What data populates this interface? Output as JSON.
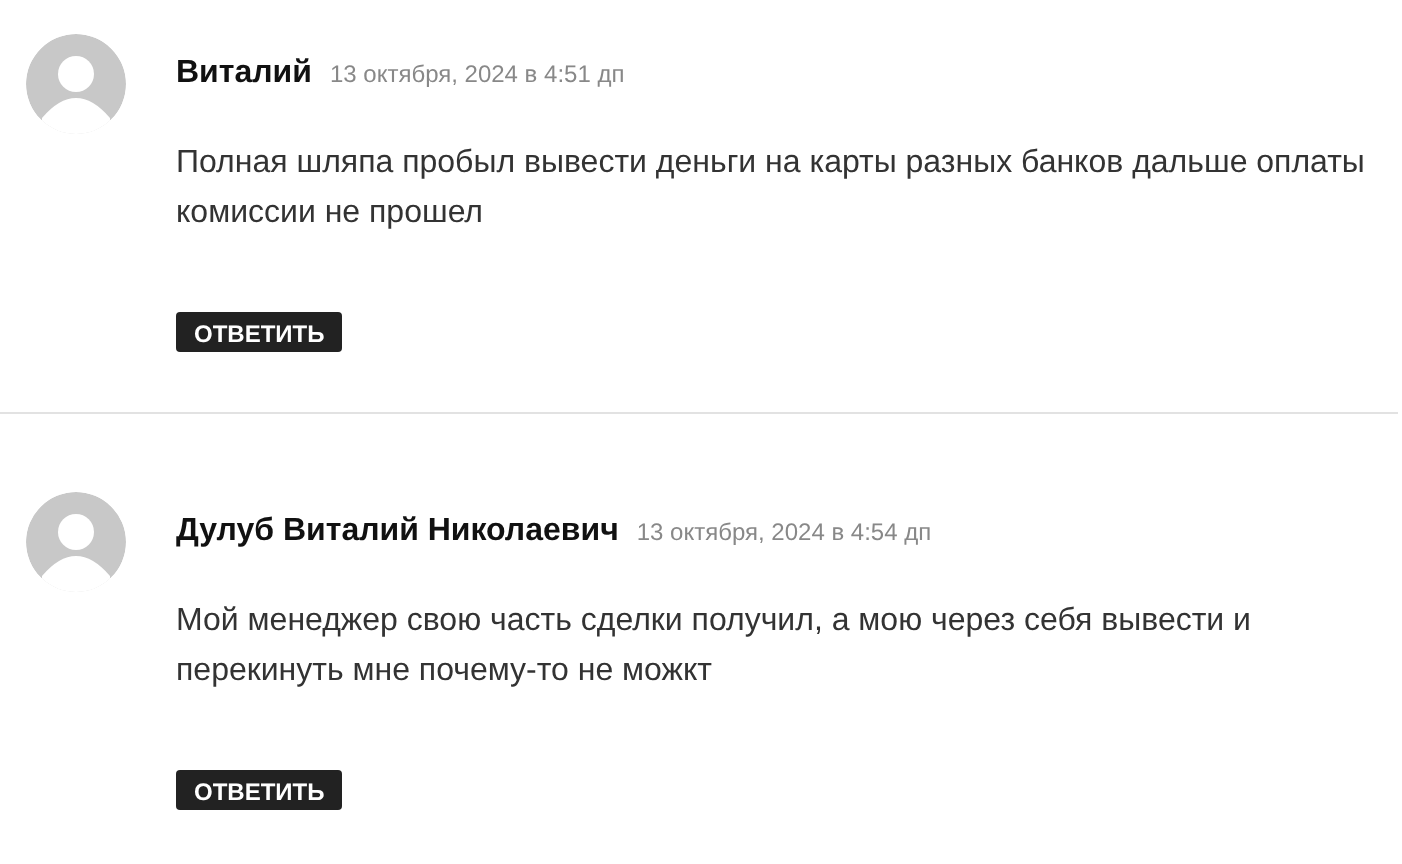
{
  "comments": [
    {
      "author": "Виталий",
      "date": "13 октября, 2024 в 4:51 дп",
      "text": "Полная шляпа пробыл вывести деньги на карты разных банков дальше оплаты комиссии не прошел",
      "reply": "ОТВЕТИТЬ"
    },
    {
      "author": "Дулуб Виталий Николаевич",
      "date": "13 октября, 2024 в 4:54 дп",
      "text": "Мой менеджер свою часть сделки получил, а мою через себя вывести и перекинуть мне почему-то не можкт",
      "reply": "ОТВЕТИТЬ"
    }
  ]
}
